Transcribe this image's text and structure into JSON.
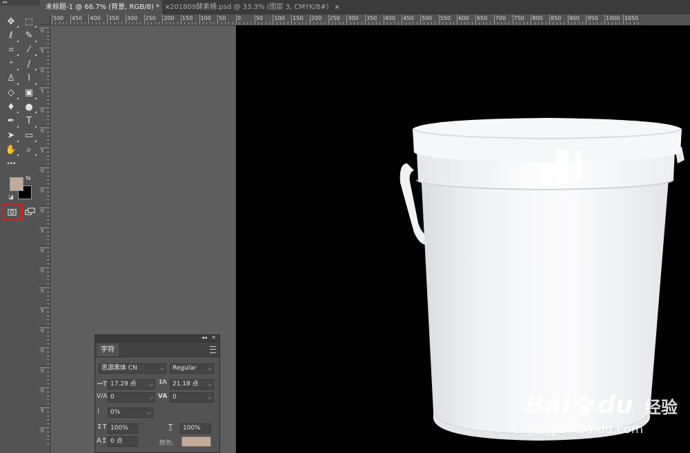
{
  "tabs": [
    {
      "label": "未标题-1 @ 66.7% (背景, RGB/8) *",
      "close": "×",
      "active": true
    },
    {
      "label": "201809酵素桶.psd @ 33.3% (图层 3, CMYK/8#)",
      "close": "×",
      "active": false
    }
  ],
  "ruler": {
    "h_labels": [
      "500",
      "450",
      "400",
      "350",
      "300",
      "250",
      "200",
      "150",
      "100",
      "50",
      "0",
      "50",
      "100",
      "150",
      "200",
      "250",
      "300",
      "350",
      "400",
      "450",
      "500",
      "550",
      "600",
      "650",
      "700",
      "750",
      "800",
      "850",
      "900",
      "950",
      "1000",
      "1050"
    ],
    "v_labels": [
      "0",
      "5",
      "0",
      "5",
      "0",
      "0",
      "5",
      "0",
      "0",
      "0",
      "5",
      "0",
      "0",
      "0",
      "5",
      "0",
      "0",
      "0",
      "0",
      "5",
      "0"
    ]
  },
  "tools": [
    {
      "name": "move-tool-icon",
      "glyph": "✥"
    },
    {
      "name": "marquee-tool-icon",
      "glyph": "⬚"
    },
    {
      "name": "lasso-tool-icon",
      "glyph": "ℓ"
    },
    {
      "name": "quick-select-tool-icon",
      "glyph": "✎"
    },
    {
      "name": "crop-tool-icon",
      "glyph": "⌗"
    },
    {
      "name": "eyedropper-tool-icon",
      "glyph": "⁄"
    },
    {
      "name": "healing-brush-tool-icon",
      "glyph": "⁺"
    },
    {
      "name": "brush-tool-icon",
      "glyph": "/"
    },
    {
      "name": "clone-stamp-tool-icon",
      "glyph": "♙"
    },
    {
      "name": "history-brush-tool-icon",
      "glyph": "⌇"
    },
    {
      "name": "eraser-tool-icon",
      "glyph": "◇"
    },
    {
      "name": "gradient-tool-icon",
      "glyph": "▣"
    },
    {
      "name": "blur-tool-icon",
      "glyph": "♦"
    },
    {
      "name": "dodge-tool-icon",
      "glyph": "●"
    },
    {
      "name": "pen-tool-icon",
      "glyph": "✒"
    },
    {
      "name": "type-tool-icon",
      "glyph": "T"
    },
    {
      "name": "path-select-tool-icon",
      "glyph": "➤"
    },
    {
      "name": "rectangle-tool-icon",
      "glyph": "▭"
    },
    {
      "name": "hand-tool-icon",
      "glyph": "✋"
    },
    {
      "name": "zoom-tool-icon",
      "glyph": "⌕"
    },
    {
      "name": "more-tools-icon",
      "glyph": "•••"
    }
  ],
  "colors": {
    "foreground": "#c4aa98",
    "background": "#000000"
  },
  "char_panel": {
    "tab": "字符",
    "font_family": "思源黑体 CN",
    "font_style": "Regular",
    "font_size": "17.29 点",
    "leading": "21.18 点",
    "kerning_label": "V/A",
    "kerning": "0",
    "tracking_label": "VA",
    "tracking": "0",
    "tsume": "0%",
    "vscale": "100%",
    "hscale": "100%",
    "baseline": "0 点",
    "color_label": "颜色:",
    "color_value": "#c4aa98"
  },
  "watermark": {
    "brand": "Bai",
    "brand2": "du",
    "suffix": "经验",
    "url": "jingyan.baidu.com"
  }
}
